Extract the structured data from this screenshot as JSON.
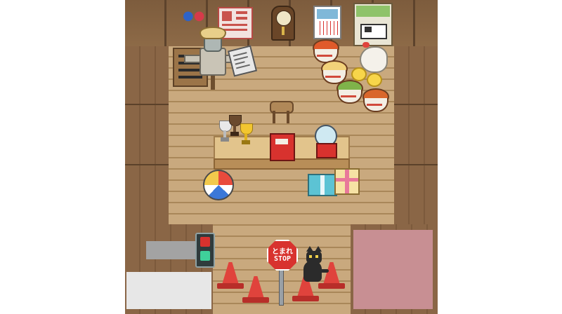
{
  "scene": {
    "stop_sign_top": "とまれ",
    "stop_sign_bottom": "STOP",
    "restroom_icons": [
      "man-figure",
      "woman-figure"
    ]
  },
  "colors": {
    "wall": "#8a6848",
    "floor": "#c9a97e",
    "counter": "#e2c48c",
    "overlay_grey": "#a3a3a3",
    "overlay_white": "#e7e7e7",
    "overlay_pink": "#c88f93",
    "accent_red": "#d8322e"
  },
  "icons": [
    "restroom-sign-icon",
    "poster-icon",
    "wall-clock-icon",
    "calendar-icon",
    "cow-picture-icon",
    "scarecrow-icon",
    "newspaper-icon",
    "menu-board-icon",
    "stool-icon",
    "ramen-bowl-icon",
    "fried-egg-bowl-icon",
    "green-bowl-icon",
    "curry-bowl-icon",
    "hen-icon",
    "chick-icon",
    "trophy-icon",
    "cash-register-icon",
    "gacha-machine-icon",
    "beach-ball-icon",
    "gift-box-icon",
    "traffic-light-icon",
    "stop-sign-icon",
    "traffic-cone-icon",
    "black-cat-icon"
  ]
}
